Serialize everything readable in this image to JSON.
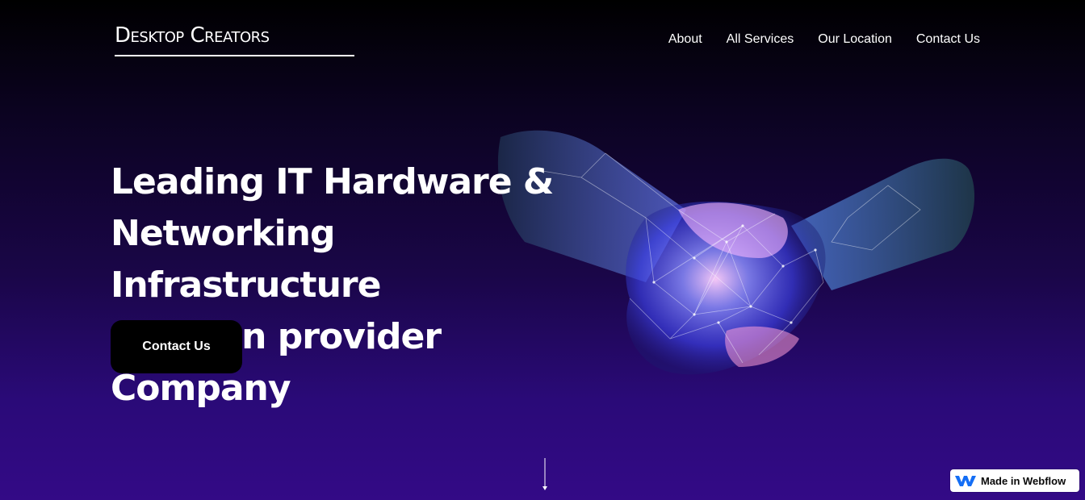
{
  "header": {
    "logo_text": "Desktop Creators",
    "nav": [
      {
        "label": "About"
      },
      {
        "label": "All Services"
      },
      {
        "label": "Our Location"
      },
      {
        "label": "Contact Us"
      }
    ]
  },
  "hero": {
    "title_lines": [
      "Leading IT Hardware &",
      "Networking Infrastructure",
      "solution provider Company"
    ],
    "cta_label": "Contact Us",
    "image_icon": "handshake-illustration"
  },
  "scroll": {
    "icon": "down-arrow-icon"
  },
  "badge": {
    "label": "Made in Webflow",
    "icon": "webflow-logo-icon",
    "brand_color": "#146ef5"
  },
  "colors": {
    "background_top": "#000000",
    "background_bottom": "#330a86",
    "button_bg": "#000000",
    "text": "#ffffff"
  }
}
